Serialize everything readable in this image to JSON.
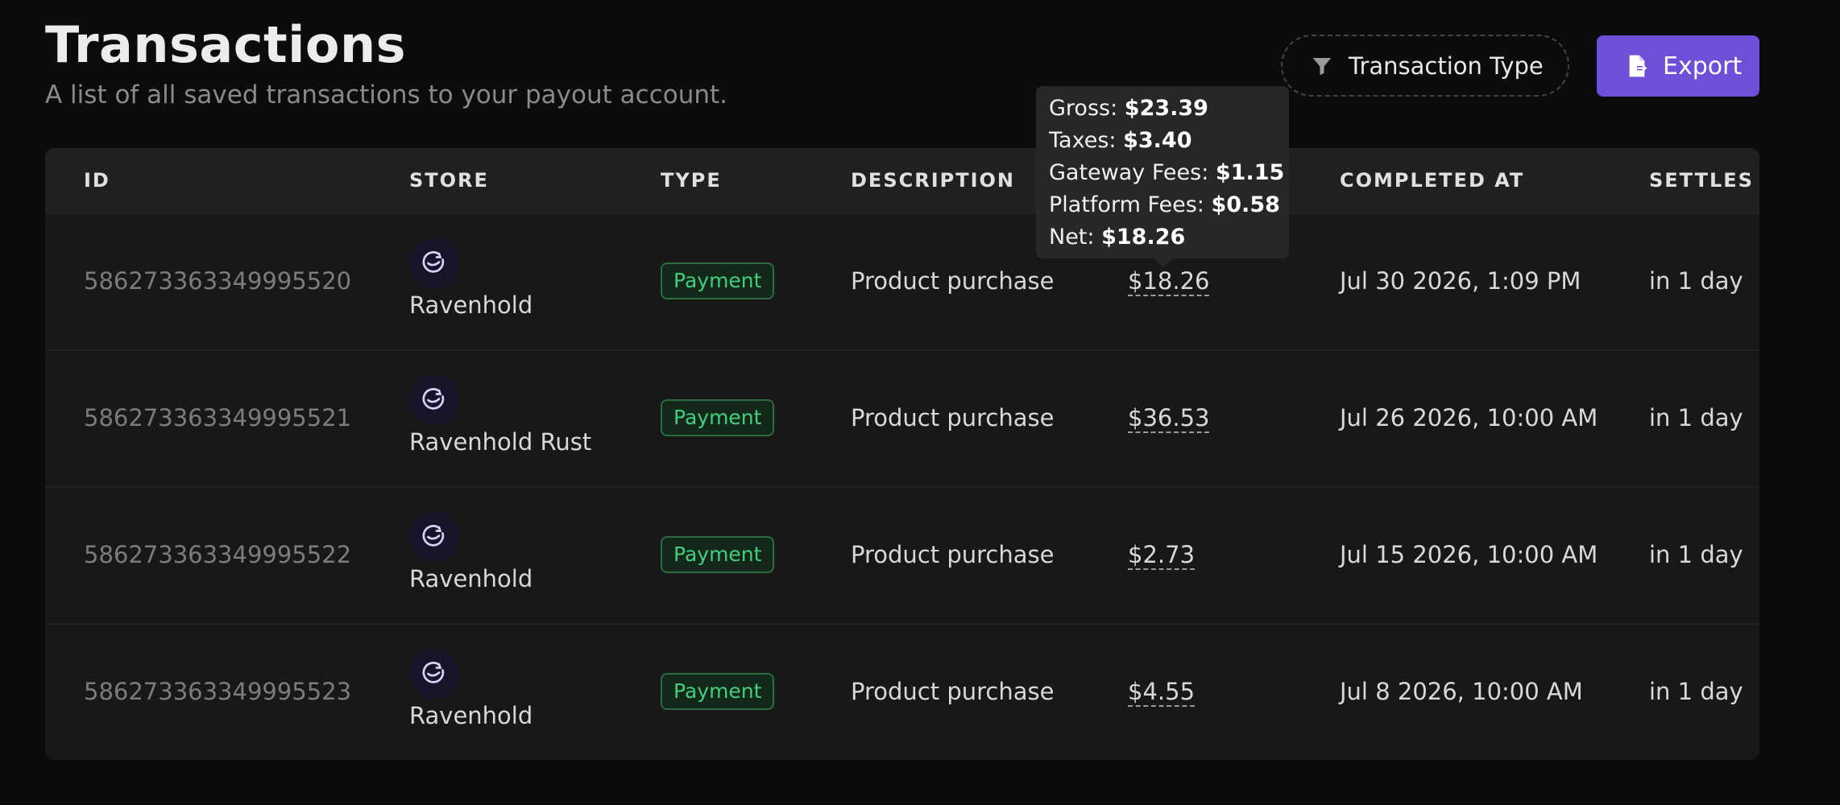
{
  "header": {
    "title": "Transactions",
    "subtitle": "A list of all saved transactions to your payout account."
  },
  "toolbar": {
    "filter_label": "Transaction Type",
    "filter_icon": "filter-icon",
    "export_label": "Export",
    "export_icon": "file-export-icon"
  },
  "table": {
    "columns": {
      "id": "ID",
      "store": "STORE",
      "type": "TYPE",
      "description": "DESCRIPTION",
      "completed_at": "COMPLETED AT",
      "settles_in": "SETTLES IN"
    },
    "rows": [
      {
        "id": "586273363349995520",
        "store": "Ravenhold",
        "type": "Payment",
        "description": "Product purchase",
        "amount": "$18.26",
        "completed_at": "Jul 30 2026, 1:09 PM",
        "settles_in": "in 1 day"
      },
      {
        "id": "586273363349995521",
        "store": "Ravenhold Rust",
        "type": "Payment",
        "description": "Product purchase",
        "amount": "$36.53",
        "completed_at": "Jul 26 2026, 10:00 AM",
        "settles_in": "in 1 day"
      },
      {
        "id": "586273363349995522",
        "store": "Ravenhold",
        "type": "Payment",
        "description": "Product purchase",
        "amount": "$2.73",
        "completed_at": "Jul 15 2026, 10:00 AM",
        "settles_in": "in 1 day"
      },
      {
        "id": "586273363349995523",
        "store": "Ravenhold",
        "type": "Payment",
        "description": "Product purchase",
        "amount": "$4.55",
        "completed_at": "Jul 8 2026, 10:00 AM",
        "settles_in": "in 1 day"
      }
    ]
  },
  "tooltip": {
    "gross_label": "Gross:",
    "gross_value": "$23.39",
    "taxes_label": "Taxes:",
    "taxes_value": "$3.40",
    "gateway_label": "Gateway Fees:",
    "gateway_value": "$1.15",
    "platform_label": "Platform Fees:",
    "platform_value": "$0.58",
    "net_label": "Net:",
    "net_value": "$18.26"
  },
  "colors": {
    "background": "#0c0c0c",
    "accent": "#6f4fd8",
    "badge_text": "#3fd07a",
    "store_avatar": "#19132a"
  },
  "icons": {
    "store_logo": "ravenhold-logo-icon"
  }
}
